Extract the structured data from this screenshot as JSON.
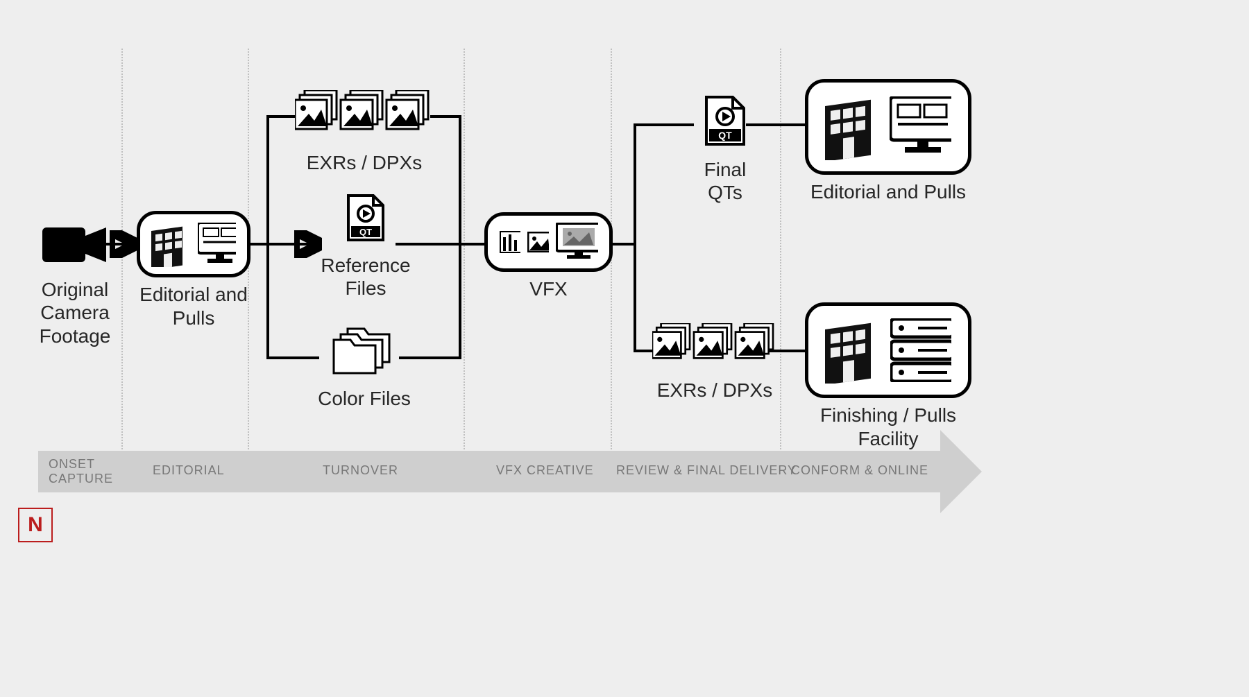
{
  "phases": {
    "onset": "ONSET CAPTURE",
    "editorial": "EDITORIAL",
    "turnover": "TURNOVER",
    "vfx": "VFX CREATIVE",
    "review": "REVIEW & FINAL DELIVERY",
    "conform": "CONFORM & ONLINE"
  },
  "nodes": {
    "camera": "Original Camera Footage",
    "editorial_pulls": "Editorial and Pulls",
    "exrs": "EXRs / DPXs",
    "reference": "Reference Files",
    "color": "Color Files",
    "vfx": "VFX",
    "final_qts": "Final QTs",
    "exrs2": "EXRs / DPXs",
    "editorial_pulls2": "Editorial and Pulls",
    "finishing": "Finishing / Pulls Facility",
    "qt_tag": "QT"
  },
  "logo": "N"
}
